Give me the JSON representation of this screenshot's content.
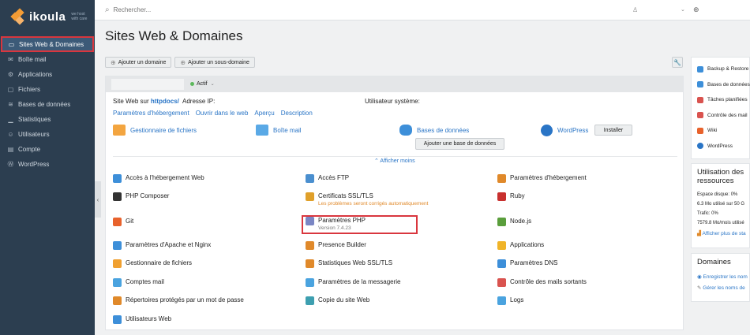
{
  "brand": {
    "name": "ikoula",
    "tagline_1": "we host",
    "tagline_2": "with care"
  },
  "sidebar": {
    "items": [
      {
        "label": "Sites Web & Domaines",
        "icon": "monitor-icon",
        "glyph": "▭",
        "active": true
      },
      {
        "label": "Boîte mail",
        "icon": "mail-icon",
        "glyph": "✉"
      },
      {
        "label": "Applications",
        "icon": "gear-icon",
        "glyph": "⚙"
      },
      {
        "label": "Fichiers",
        "icon": "folder-icon",
        "glyph": "▢"
      },
      {
        "label": "Bases de données",
        "icon": "database-icon",
        "glyph": "≋"
      },
      {
        "label": "Statistiques",
        "icon": "chart-icon",
        "glyph": "▁"
      },
      {
        "label": "Utilisateurs",
        "icon": "user-icon",
        "glyph": "☺"
      },
      {
        "label": "Compte",
        "icon": "briefcase-icon",
        "glyph": "▤"
      },
      {
        "label": "WordPress",
        "icon": "wordpress-icon",
        "glyph": "Ⓦ"
      }
    ],
    "collapse_glyph": "‹"
  },
  "topbar": {
    "search_placeholder": "Rechercher...",
    "user_glyph": "♙",
    "dropdown_glyph": "⌄",
    "globe_glyph": "⊕"
  },
  "page": {
    "title": "Sites Web & Domaines"
  },
  "toolbar": {
    "add_domain": "Ajouter un domaine",
    "add_subdomain": "Ajouter un sous-domaine",
    "wrench_glyph": "🔧"
  },
  "domain": {
    "status": "Actif",
    "site_prefix": "Site Web sur ",
    "site_path": "httpdocs/",
    "ip_label": "Adresse IP:",
    "sysuser_label": "Utilisateur système:",
    "links": [
      "Paramètres d'hébergement",
      "Ouvrir dans le web",
      "Aperçu",
      "Description"
    ],
    "tools": {
      "files": "Gestionnaire de fichiers",
      "mail": "Boîte mail",
      "db": "Bases de données",
      "wordpress": "WordPress",
      "install_btn": "Installer",
      "add_db_btn": "Ajouter une base de données"
    },
    "show_less": "⌃ Afficher moins",
    "features": [
      {
        "label": "Accès à l'hébergement Web",
        "color": "#3d8fd9"
      },
      {
        "label": "Accès FTP",
        "color": "#4a8fcf"
      },
      {
        "label": "Paramètres d'hébergement",
        "color": "#e0892a"
      },
      {
        "label": "PHP Composer",
        "color": "#333333"
      },
      {
        "label": "Certificats SSL/TLS",
        "sub": "Les problèmes seront corrigés automatiquement",
        "color": "#e0a02a"
      },
      {
        "label": "Ruby",
        "color": "#c8302e"
      },
      {
        "label": "Git",
        "color": "#e8622c"
      },
      {
        "label": "Paramètres PHP",
        "sub": "Version 7.4.23",
        "color": "#7a86c4"
      },
      {
        "label": "Node.js",
        "color": "#5a9e3c"
      },
      {
        "label": "Paramètres d'Apache et Nginx",
        "color": "#3d8fd9"
      },
      {
        "label": "Presence Builder",
        "color": "#e0892a"
      },
      {
        "label": "Applications",
        "color": "#f0b429"
      },
      {
        "label": "Gestionnaire de fichiers",
        "color": "#f0a030"
      },
      {
        "label": "Statistiques Web SSL/TLS",
        "color": "#e0892a"
      },
      {
        "label": "Paramètres DNS",
        "color": "#3d8fd9"
      },
      {
        "label": "Comptes mail",
        "color": "#4aa3df"
      },
      {
        "label": "Paramètres de la messagerie",
        "color": "#4aa3df"
      },
      {
        "label": "Contrôle des mails sortants",
        "color": "#d9534f"
      },
      {
        "label": "Répertoires protégés par un mot de passe",
        "color": "#e0892a"
      },
      {
        "label": "Copie du site Web",
        "color": "#3d9fb0"
      },
      {
        "label": "Logs",
        "color": "#4aa3df"
      },
      {
        "label": "Utilisateurs Web",
        "color": "#3d8fd9"
      }
    ]
  },
  "right": {
    "links": [
      {
        "label": "Backup & Restore",
        "color": "#3d8fd9"
      },
      {
        "label": "Bases de données",
        "color": "#3d8fd9"
      },
      {
        "label": "Tâches planifiées",
        "color": "#d9534f"
      },
      {
        "label": "Contrôle des mail",
        "color": "#d9534f"
      },
      {
        "label": "Wiki",
        "color": "#e8622c"
      },
      {
        "label": "WordPress",
        "color": "#2a75c6"
      }
    ],
    "usage": {
      "title_1": "Utilisation des",
      "title_2": "ressources",
      "disk_label": "Espace disque: 0%",
      "disk_detail": "6.3 Mo utilisé sur 50 G",
      "traffic_label": "Trafic: 0%",
      "traffic_detail": "7579.8 Mo/mois utilisé",
      "more": "Afficher plus de sta"
    },
    "domains": {
      "title": "Domaines",
      "register": "Enregistrer les nom",
      "manage": "Gérer les noms de"
    }
  }
}
